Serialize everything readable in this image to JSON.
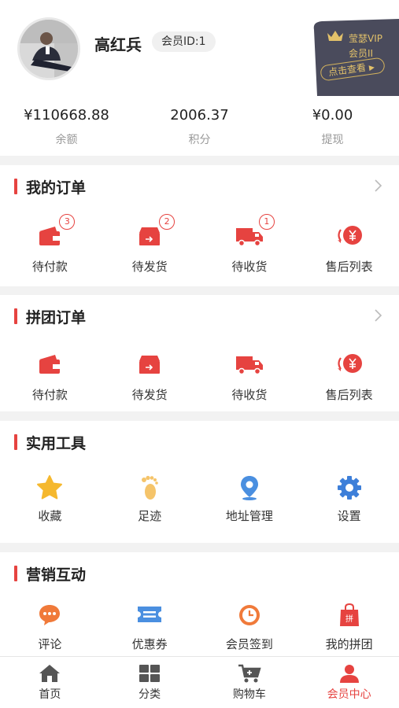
{
  "user": {
    "name": "高红兵",
    "member_id": "会员ID:1"
  },
  "vip_card": {
    "title": "莹瑟VIP",
    "level": "会员II",
    "button": "点击查看"
  },
  "stats": [
    {
      "value": "¥110668.88",
      "label": "余额"
    },
    {
      "value": "2006.37",
      "label": "积分"
    },
    {
      "value": "¥0.00",
      "label": "提现"
    }
  ],
  "my_orders": {
    "title": "我的订单",
    "items": [
      {
        "label": "待付款",
        "icon": "wallet-icon",
        "badge": "3"
      },
      {
        "label": "待发货",
        "icon": "shipment-box-icon",
        "badge": "2"
      },
      {
        "label": "待收货",
        "icon": "delivery-truck-icon",
        "badge": "1"
      },
      {
        "label": "售后列表",
        "icon": "refund-yen-icon"
      }
    ]
  },
  "group_orders": {
    "title": "拼团订单",
    "items": [
      {
        "label": "待付款",
        "icon": "wallet-icon"
      },
      {
        "label": "待发货",
        "icon": "shipment-box-icon"
      },
      {
        "label": "待收货",
        "icon": "delivery-truck-icon"
      },
      {
        "label": "售后列表",
        "icon": "refund-yen-icon"
      }
    ]
  },
  "tools": {
    "title": "实用工具",
    "items": [
      {
        "label": "收藏",
        "icon": "star-icon"
      },
      {
        "label": "足迹",
        "icon": "footprint-icon"
      },
      {
        "label": "地址管理",
        "icon": "location-pin-icon"
      },
      {
        "label": "设置",
        "icon": "gear-icon"
      }
    ]
  },
  "marketing": {
    "title": "营销互动",
    "items": [
      {
        "label": "评论",
        "icon": "comment-icon"
      },
      {
        "label": "优惠券",
        "icon": "coupon-icon"
      },
      {
        "label": "会员签到",
        "icon": "clock-icon"
      },
      {
        "label": "我的拼团",
        "icon": "group-bag-icon",
        "icon_text": "拼"
      }
    ]
  },
  "tabbar": [
    {
      "label": "首页",
      "icon": "home-icon",
      "active": false
    },
    {
      "label": "分类",
      "icon": "category-grid-icon",
      "active": false
    },
    {
      "label": "购物车",
      "icon": "shopping-cart-icon",
      "active": false
    },
    {
      "label": "会员中心",
      "icon": "user-icon",
      "active": true
    }
  ],
  "colors": {
    "accent": "#e64340",
    "star": "#f5b82e",
    "footprint": "#f5c46a",
    "pin": "#4a8fe0",
    "gear": "#3d7fd9",
    "comment": "#f07a3a",
    "coupon": "#4a8fe0",
    "clock": "#f07a3a",
    "tab_icon": "#555555",
    "vip_card": "#4a4b5c",
    "vip_gold": "#e2c16a"
  }
}
